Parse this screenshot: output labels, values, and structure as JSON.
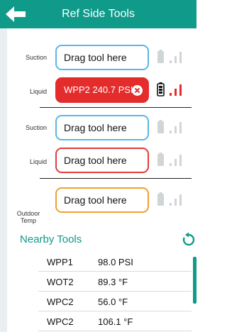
{
  "header": {
    "title": "Ref Side Tools"
  },
  "sections": [
    {
      "label": "Suction",
      "slot_text": "Drag tool here",
      "style": "blue"
    },
    {
      "label": "Liquid",
      "slot_text": "WPP2 240.7 PSI",
      "style": "active"
    },
    {
      "label": "Suction",
      "slot_text": "Drag tool here",
      "style": "blue"
    },
    {
      "label": "Liquid",
      "slot_text": "Drag tool here",
      "style": "red"
    },
    {
      "label": "Outdoor\nTemp",
      "slot_text": "Drag tool here",
      "style": "orange"
    }
  ],
  "labels": {
    "suction1": "Suction",
    "liquid1": "Liquid",
    "suction2": "Suction",
    "liquid2": "Liquid",
    "outdoor": "Outdoor",
    "temp": "Temp"
  },
  "slots": {
    "s1": "Drag tool here",
    "l1": "WPP2 240.7 PSI",
    "s2": "Drag tool here",
    "l2": "Drag tool here",
    "o1": "Drag tool here"
  },
  "nearby": {
    "title": "Nearby Tools",
    "rows": [
      {
        "name": "WPP1",
        "value": "98.0 PSI"
      },
      {
        "name": "WOT2",
        "value": "89.3 °F"
      },
      {
        "name": "WPC2",
        "value": "56.0 °F"
      },
      {
        "name": "WPC2",
        "value": "106.1 °F"
      }
    ]
  },
  "colors": {
    "accent": "#0f9a8a",
    "active": "#e52c2c",
    "blue_border": "#5ab6ea",
    "red_border": "#e23b3b",
    "orange_border": "#f0a030"
  },
  "icons": [
    "back-arrow-icon",
    "battery-icon",
    "signal-bars-icon",
    "close-icon",
    "refresh-icon"
  ]
}
